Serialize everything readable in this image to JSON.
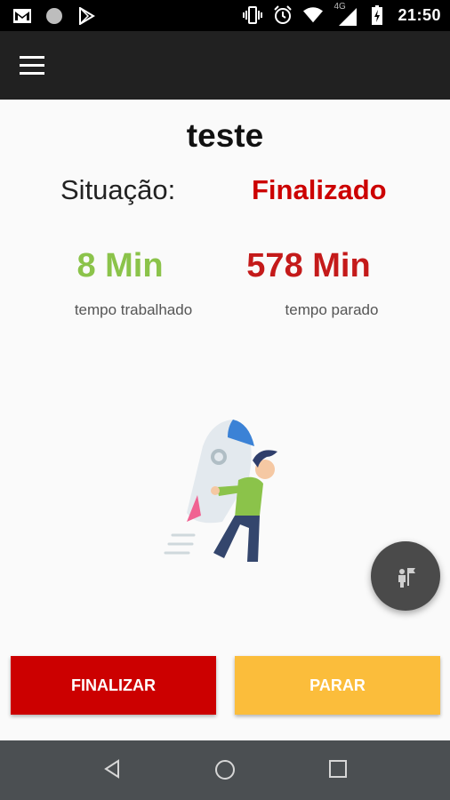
{
  "status_bar": {
    "left_icons": [
      "gmail-icon",
      "circle-notification-icon",
      "play-store-icon"
    ],
    "right_icons": [
      "vibrate-icon",
      "alarm-icon",
      "wifi-icon",
      "signal-icon",
      "battery-icon"
    ],
    "network": "4G",
    "time": "21:50"
  },
  "app_bar": {
    "menu_icon": "hamburger-menu-icon"
  },
  "main": {
    "title": "teste",
    "situacao_label": "Situação:",
    "situacao_value": "Finalizado",
    "worked_time": "8 Min",
    "worked_label": "tempo trabalhado",
    "stopped_time": "578 Min",
    "stopped_label": "tempo parado"
  },
  "fab": {
    "icon": "person-flag-icon"
  },
  "actions": {
    "finalizar_label": "FINALIZAR",
    "parar_label": "PARAR"
  },
  "nav_bar": {
    "icons": [
      "back-icon",
      "home-icon",
      "recents-icon"
    ]
  },
  "colors": {
    "finalizado": "#cc0000",
    "worked": "#8bc34a",
    "stopped": "#c41a1a",
    "finalizar_button": "#cc0000",
    "parar_button": "#fbbd3b"
  }
}
